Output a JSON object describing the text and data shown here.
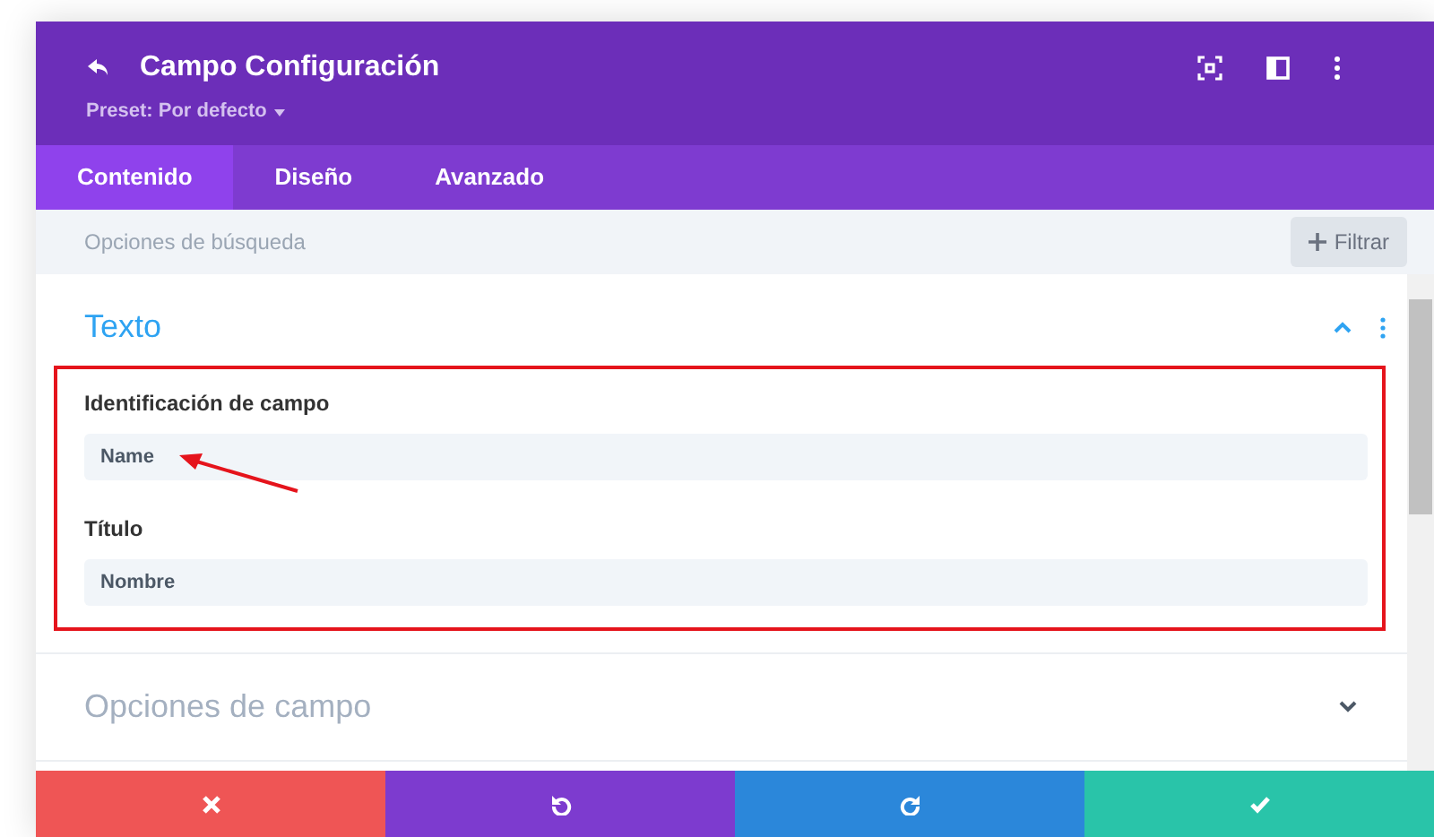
{
  "panel": {
    "title": "Campo Configuración",
    "preset": "Preset: Por defecto",
    "tabs": [
      {
        "label": "Contenido",
        "selected": true
      },
      {
        "label": "Diseño",
        "selected": false
      },
      {
        "label": "Avanzado",
        "selected": false
      }
    ],
    "search": {
      "placeholder": "Opciones de búsqueda"
    },
    "filter_button": "Filtrar",
    "sections": [
      {
        "title": "Texto",
        "expanded": true,
        "fields": [
          {
            "label": "Identificación de campo",
            "value": "Name"
          },
          {
            "label": "Título",
            "value": "Nombre"
          }
        ]
      },
      {
        "title": "Opciones de campo",
        "expanded": false
      }
    ]
  },
  "actions": [
    {
      "kind": "discard"
    },
    {
      "kind": "undo"
    },
    {
      "kind": "redo"
    },
    {
      "kind": "save"
    }
  ]
}
